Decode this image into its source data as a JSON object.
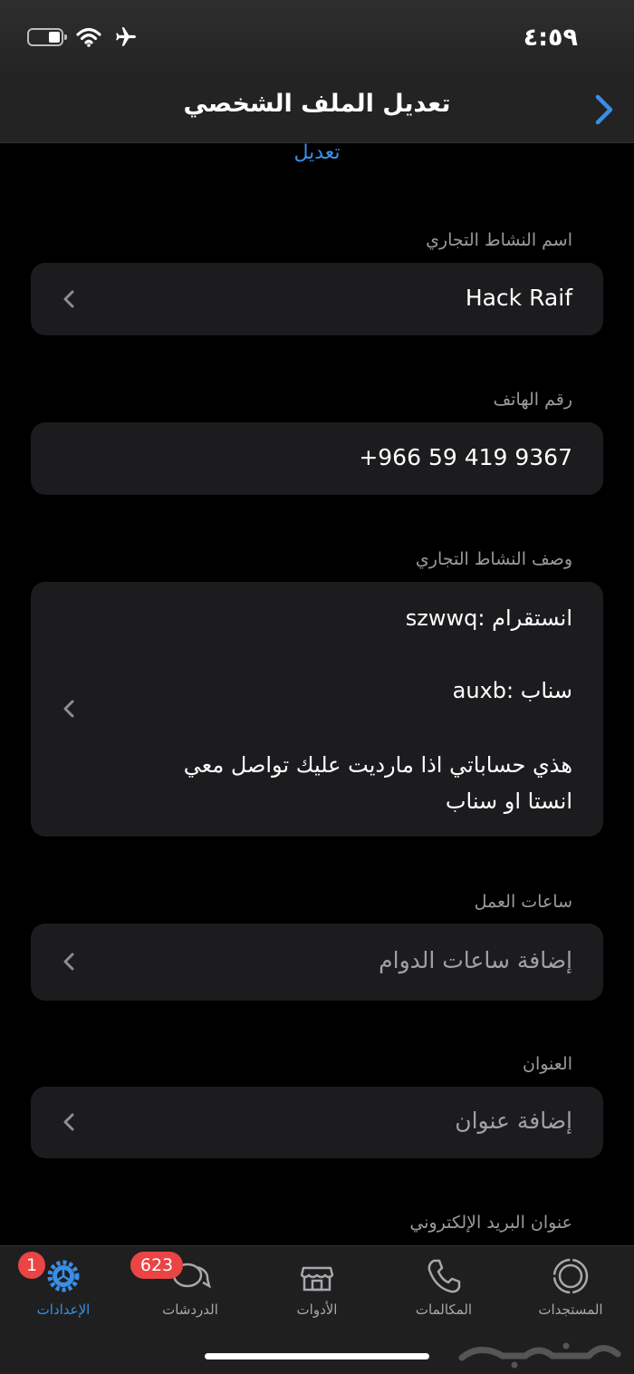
{
  "status_bar": {
    "time": "٤:٥٩"
  },
  "nav": {
    "title": "تعديل الملف الشخصي"
  },
  "edit_link": "تعديل",
  "fields": {
    "business_name": {
      "label": "اسم النشاط التجاري",
      "value": "Hack Raif"
    },
    "phone": {
      "label": "رقم الهاتف",
      "value": "+966 59 419 9367"
    },
    "description": {
      "label": "وصف النشاط التجاري",
      "lines": [
        "انستقرام :szwwq",
        "سناب :auxb",
        "هذي حساباتي اذا ماردیت علیك تواصل معي",
        "انستا او سناب"
      ]
    },
    "hours": {
      "label": "ساعات العمل",
      "placeholder": "إضافة ساعات الدوام"
    },
    "address": {
      "label": "العنوان",
      "placeholder": "إضافة عنوان"
    },
    "email": {
      "label": "عنوان البريد الإلكتروني"
    }
  },
  "tabs": [
    {
      "label": "الإعدادات",
      "badge": "1",
      "icon": "settings-gear-icon",
      "active": true
    },
    {
      "label": "الدردشات",
      "badge": "623",
      "icon": "chats-icon"
    },
    {
      "label": "الأدوات",
      "icon": "store-icon"
    },
    {
      "label": "المكالمات",
      "icon": "phone-icon"
    },
    {
      "label": "المستجدات",
      "icon": "status-icon"
    }
  ],
  "colors": {
    "accent": "#3a8ee6",
    "badge": "#ea4444",
    "field_bg": "#1c1c1e"
  }
}
